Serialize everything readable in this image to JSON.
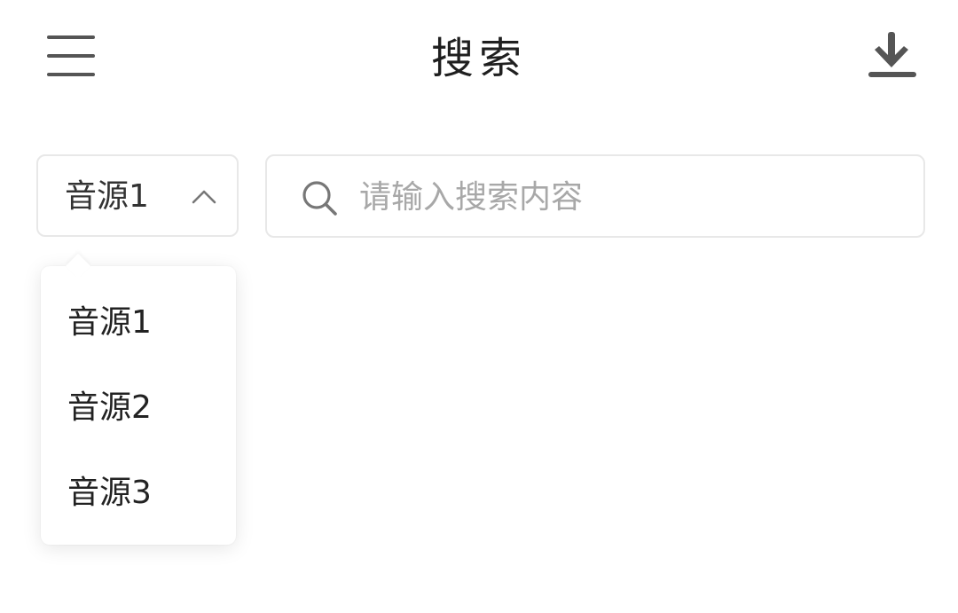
{
  "header": {
    "title": "搜索",
    "menu_icon": "hamburger-menu-icon",
    "download_icon": "download-icon",
    "icon_color": "#555555"
  },
  "source_select": {
    "selected": "音源1",
    "expanded": true,
    "chevron_icon": "chevron-up-icon",
    "options": [
      {
        "label": "音源1"
      },
      {
        "label": "音源2"
      },
      {
        "label": "音源3"
      }
    ]
  },
  "search": {
    "icon": "search-icon",
    "placeholder": "请输入搜索内容",
    "value": ""
  },
  "colors": {
    "border": "#e8e8e8",
    "placeholder": "#a8a8a8",
    "text": "#222222"
  }
}
